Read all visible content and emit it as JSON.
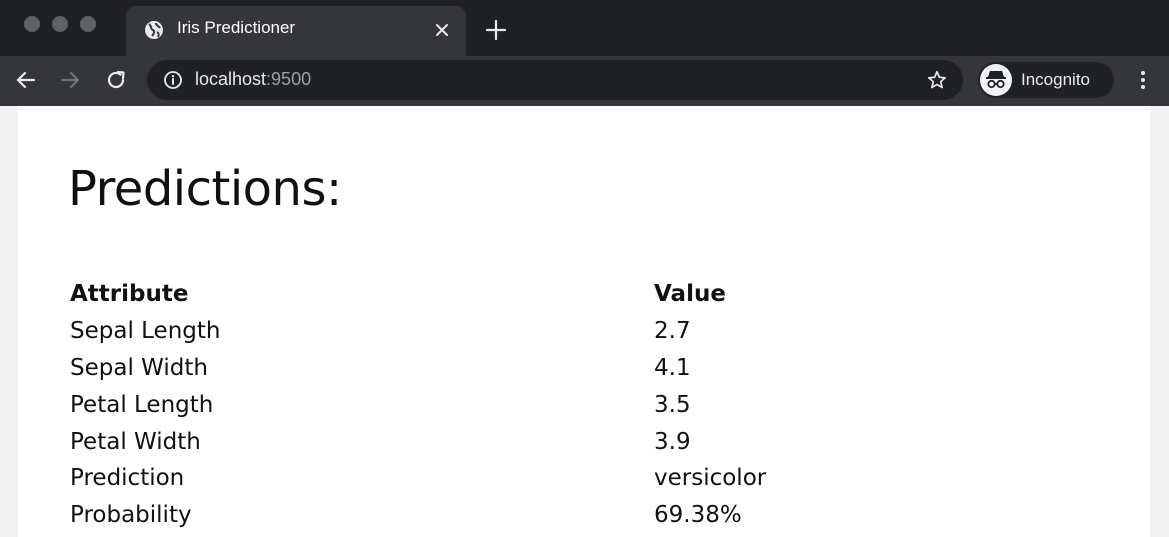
{
  "browser": {
    "tab_title": "Iris Predictioner",
    "url_host": "localhost",
    "url_port": ":9500",
    "profile_label": "Incognito"
  },
  "page": {
    "heading": "Predictions:",
    "table": {
      "headers": [
        "Attribute",
        "Value"
      ],
      "rows": [
        [
          "Sepal Length",
          "2.7"
        ],
        [
          "Sepal Width",
          "4.1"
        ],
        [
          "Petal Length",
          "3.5"
        ],
        [
          "Petal Width",
          "3.9"
        ],
        [
          "Prediction",
          "versicolor"
        ],
        [
          "Probability",
          "69.38%"
        ]
      ]
    }
  },
  "colors": {
    "tabstrip_bg": "#202124",
    "toolbar_bg": "#35363a",
    "page_bg": "#ffffff",
    "text": "#111111"
  }
}
